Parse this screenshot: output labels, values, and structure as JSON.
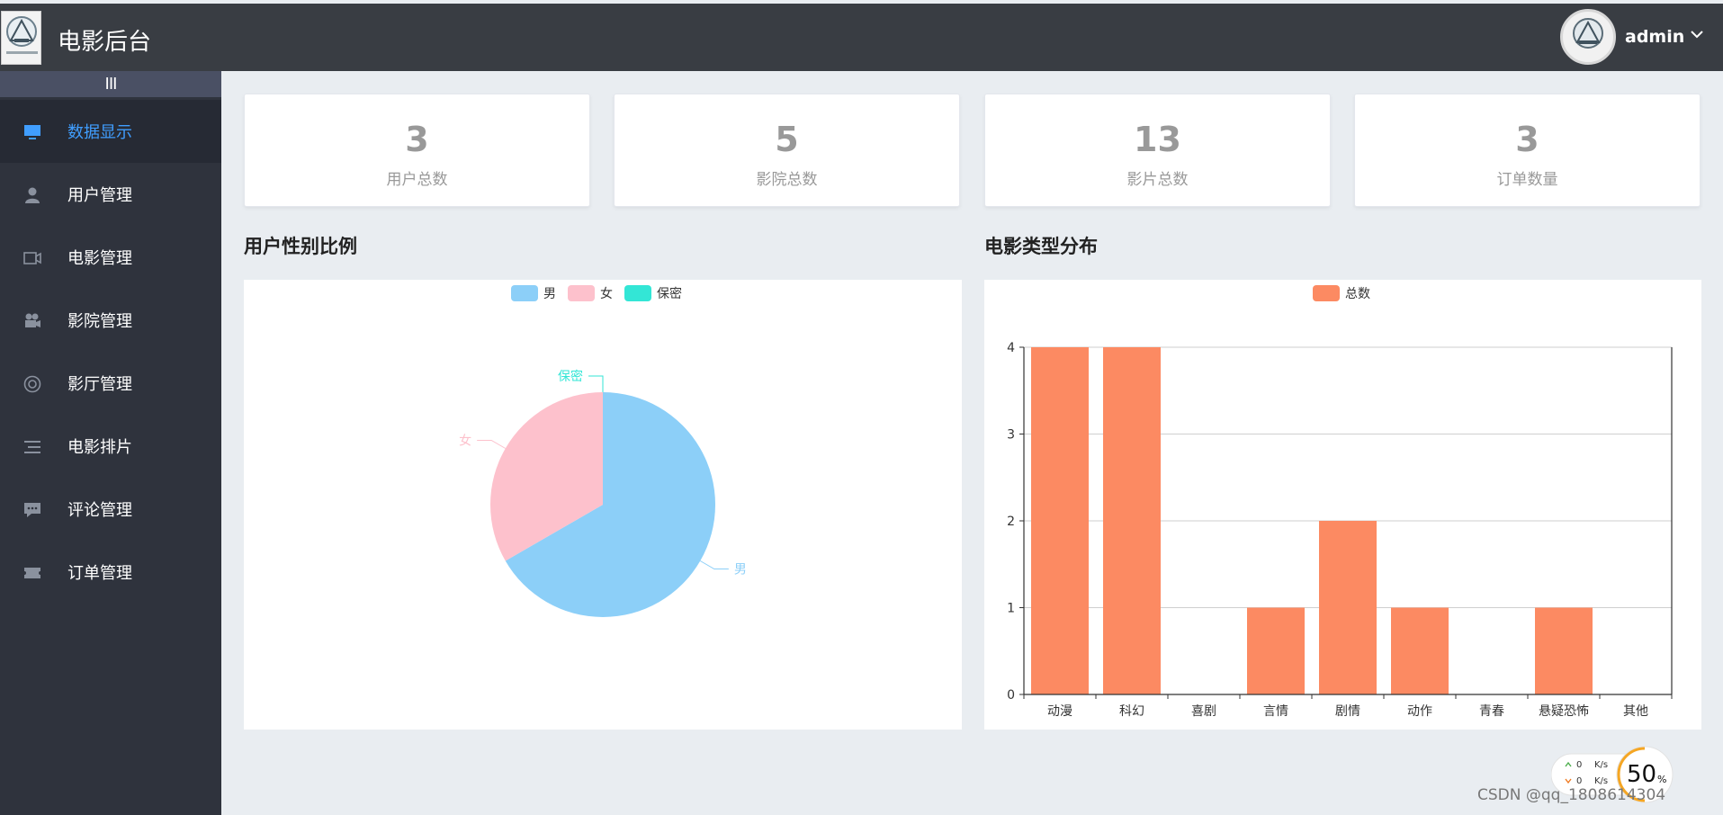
{
  "header": {
    "title": "电影后台",
    "user": "admin"
  },
  "sidebar": {
    "collapse_label": "III",
    "items": [
      {
        "label": "数据显示",
        "icon": "monitor-icon",
        "active": true
      },
      {
        "label": "用户管理",
        "icon": "user-icon",
        "active": false
      },
      {
        "label": "电影管理",
        "icon": "video-camera-icon",
        "active": false
      },
      {
        "label": "影院管理",
        "icon": "movie-camera-icon",
        "active": false
      },
      {
        "label": "影厅管理",
        "icon": "lifebuoy-icon",
        "active": false
      },
      {
        "label": "电影排片",
        "icon": "list-icon",
        "active": false
      },
      {
        "label": "评论管理",
        "icon": "comment-icon",
        "active": false
      },
      {
        "label": "订单管理",
        "icon": "ticket-icon",
        "active": false
      }
    ]
  },
  "stats": [
    {
      "value": "3",
      "label": "用户总数"
    },
    {
      "value": "5",
      "label": "影院总数"
    },
    {
      "value": "13",
      "label": "影片总数"
    },
    {
      "value": "3",
      "label": "订单数量"
    }
  ],
  "sections": {
    "gender_title": "用户性别比例",
    "genre_title": "电影类型分布"
  },
  "chart_data": [
    {
      "type": "pie",
      "legend": [
        "男",
        "女",
        "保密"
      ],
      "legend_position": "top-center",
      "colors": [
        "#8ccff8",
        "#fdc1cc",
        "#33e6d6"
      ],
      "slices": [
        {
          "name": "男",
          "value": 2
        },
        {
          "name": "女",
          "value": 1
        },
        {
          "name": "保密",
          "value": 0
        }
      ]
    },
    {
      "type": "bar",
      "legend": [
        "总数"
      ],
      "legend_position": "top-center",
      "color": "#fc8a62",
      "categories": [
        "动漫",
        "科幻",
        "喜剧",
        "言情",
        "剧情",
        "动作",
        "青春",
        "悬疑恐怖",
        "其他"
      ],
      "series": [
        {
          "name": "总数",
          "values": [
            4,
            4,
            0,
            1,
            2,
            1,
            0,
            1,
            0
          ]
        }
      ],
      "ylim": [
        0,
        4
      ],
      "yticks": [
        "0",
        "1",
        "2",
        "3",
        "4"
      ],
      "grid": true
    }
  ],
  "net_widget": {
    "up": "0",
    "down": "0",
    "unit": "K/s",
    "percent": "50",
    "percent_unit": "%"
  },
  "watermark": "CSDN @qq_1808614304"
}
